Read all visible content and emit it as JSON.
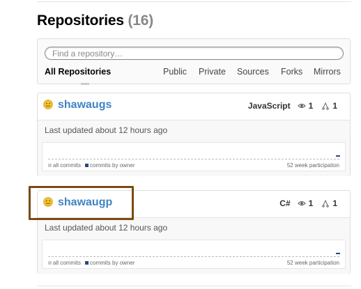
{
  "header": {
    "title": "Repositories",
    "count": "(16)"
  },
  "search": {
    "placeholder": "Find a repository…",
    "value": ""
  },
  "filters": {
    "all": "All Repositories",
    "public": "Public",
    "private": "Private",
    "sources": "Sources",
    "forks": "Forks",
    "mirrors": "Mirrors"
  },
  "repos": [
    {
      "name": "shawaugs",
      "language": "JavaScript",
      "watchers": "1",
      "forks": "1",
      "updated": "Last updated about 12 hours ago",
      "legend_all": "all commits",
      "legend_owner": "commits by owner",
      "participation": "52 week participation"
    },
    {
      "name": "shawaugp",
      "language": "C#",
      "watchers": "1",
      "forks": "1",
      "updated": "Last updated about 12 hours ago",
      "legend_all": "all commits",
      "legend_owner": "commits by owner",
      "participation": "52 week participation"
    }
  ],
  "colors": {
    "link": "#4183c4",
    "highlight_border": "#7a4a10",
    "owner_commits": "#2a4a7c",
    "all_commits": "#cccccc"
  },
  "icons": {
    "repo_status": "smiley-icon",
    "watchers": "eye-icon",
    "forks": "fork-icon"
  }
}
